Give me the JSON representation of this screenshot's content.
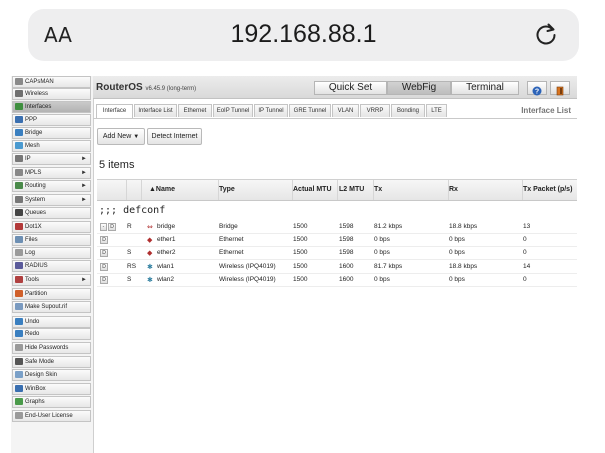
{
  "browser": {
    "font_size_label": "AA",
    "url": "192.168.88.1",
    "reload_icon": "reload-icon"
  },
  "header": {
    "brand": "RouterOS",
    "version": "v6.45.9 (long-term)",
    "buttons": [
      "Quick Set",
      "WebFig",
      "Terminal"
    ],
    "active_button": "WebFig"
  },
  "sidebar": {
    "items": [
      {
        "label": "CAPsMAN",
        "icon": "capsman-icon",
        "color": "#8a8a8a",
        "arrow": false
      },
      {
        "label": "Wireless",
        "icon": "wireless-icon",
        "color": "#6f6f6f",
        "arrow": false
      },
      {
        "label": "Interfaces",
        "icon": "interfaces-icon",
        "color": "#3f8f3f",
        "arrow": false,
        "active": true
      },
      {
        "label": "PPP",
        "icon": "ppp-icon",
        "color": "#3a6fb0",
        "arrow": false
      },
      {
        "label": "Bridge",
        "icon": "bridge-icon",
        "color": "#3a7fc0",
        "arrow": false
      },
      {
        "label": "Mesh",
        "icon": "mesh-icon",
        "color": "#4a9ad0",
        "arrow": false
      },
      {
        "label": "IP",
        "icon": "ip-icon",
        "color": "#777777",
        "arrow": true
      },
      {
        "label": "MPLS",
        "icon": "mpls-icon",
        "color": "#888888",
        "arrow": true
      },
      {
        "label": "Routing",
        "icon": "routing-icon",
        "color": "#4a8a4a",
        "arrow": true
      },
      {
        "label": "System",
        "icon": "system-icon",
        "color": "#777777",
        "arrow": true
      },
      {
        "label": "Queues",
        "icon": "queues-icon",
        "color": "#444444",
        "arrow": false
      },
      {
        "label": "Dot1X",
        "icon": "dot1x-icon",
        "color": "#b33a3a",
        "arrow": false
      },
      {
        "label": "Files",
        "icon": "files-icon",
        "color": "#6d8fb3",
        "arrow": false
      },
      {
        "label": "Log",
        "icon": "log-icon",
        "color": "#9a9a9a",
        "arrow": false
      },
      {
        "label": "RADIUS",
        "icon": "radius-icon",
        "color": "#5a5a9a",
        "arrow": false
      },
      {
        "label": "Tools",
        "icon": "tools-icon",
        "color": "#b04040",
        "arrow": true
      },
      {
        "label": "Partition",
        "icon": "partition-icon",
        "color": "#d0602a",
        "arrow": false
      },
      {
        "label": "Make Supout.rif",
        "icon": "supout-icon",
        "color": "#7a9ac0",
        "arrow": false
      },
      {
        "label": "Undo",
        "icon": "undo-icon",
        "color": "#3a7fc0",
        "arrow": false
      },
      {
        "label": "Redo",
        "icon": "redo-icon",
        "color": "#3a7fc0",
        "arrow": false
      },
      {
        "label": "Hide Passwords",
        "icon": "hide-passwords-icon",
        "color": "#9a9a9a",
        "arrow": false
      },
      {
        "label": "Safe Mode",
        "icon": "safe-mode-icon",
        "color": "#555555",
        "arrow": false
      },
      {
        "label": "Design Skin",
        "icon": "design-skin-icon",
        "color": "#7aa0c8",
        "arrow": false
      },
      {
        "label": "WinBox",
        "icon": "winbox-icon",
        "color": "#3a6fb0",
        "arrow": false
      },
      {
        "label": "Graphs",
        "icon": "graphs-icon",
        "color": "#4a9a4a",
        "arrow": false
      },
      {
        "label": "End-User License",
        "icon": "license-icon",
        "color": "#9a9a9a",
        "arrow": false
      }
    ]
  },
  "tabs": {
    "items": [
      "Interface",
      "Interface List",
      "Ethernet",
      "EoIP Tunnel",
      "IP Tunnel",
      "GRE Tunnel",
      "VLAN",
      "VRRP",
      "Bonding",
      "LTE"
    ],
    "active": "Interface",
    "section_title": "Interface List"
  },
  "toolbar": {
    "add_new": "Add New",
    "detect_internet": "Detect Internet"
  },
  "table": {
    "count_label": "5 items",
    "columns": [
      "▲Name",
      "Type",
      "Actual MTU",
      "L2 MTU",
      "Tx",
      "Rx",
      "Tx Packet (p/s)"
    ],
    "group_label": ";;; defconf",
    "rows": [
      {
        "flags": "R",
        "name": "bridge",
        "icon": "bridge-port-icon",
        "type": "Bridge",
        "actual_mtu": "1500",
        "l2_mtu": "1598",
        "tx": "81.2 kbps",
        "rx": "18.8 kbps",
        "tx_pps": "13",
        "buttons": [
          "-",
          "D"
        ]
      },
      {
        "flags": "",
        "name": "ether1",
        "icon": "ethernet-port-icon",
        "type": "Ethernet",
        "actual_mtu": "1500",
        "l2_mtu": "1598",
        "tx": "0 bps",
        "rx": "0 bps",
        "tx_pps": "0",
        "buttons": [
          "D"
        ]
      },
      {
        "flags": "S",
        "name": "ether2",
        "icon": "ethernet-port-icon",
        "type": "Ethernet",
        "actual_mtu": "1500",
        "l2_mtu": "1598",
        "tx": "0 bps",
        "rx": "0 bps",
        "tx_pps": "0",
        "buttons": [
          "D"
        ]
      },
      {
        "flags": "RS",
        "name": "wlan1",
        "icon": "wireless-port-icon",
        "type": "Wireless (IPQ4019)",
        "actual_mtu": "1500",
        "l2_mtu": "1600",
        "tx": "81.7 kbps",
        "rx": "18.8 kbps",
        "tx_pps": "14",
        "buttons": [
          "D"
        ]
      },
      {
        "flags": "S",
        "name": "wlan2",
        "icon": "wireless-port-icon",
        "type": "Wireless (IPQ4019)",
        "actual_mtu": "1500",
        "l2_mtu": "1600",
        "tx": "0 bps",
        "rx": "0 bps",
        "tx_pps": "0",
        "buttons": [
          "D"
        ]
      }
    ]
  }
}
